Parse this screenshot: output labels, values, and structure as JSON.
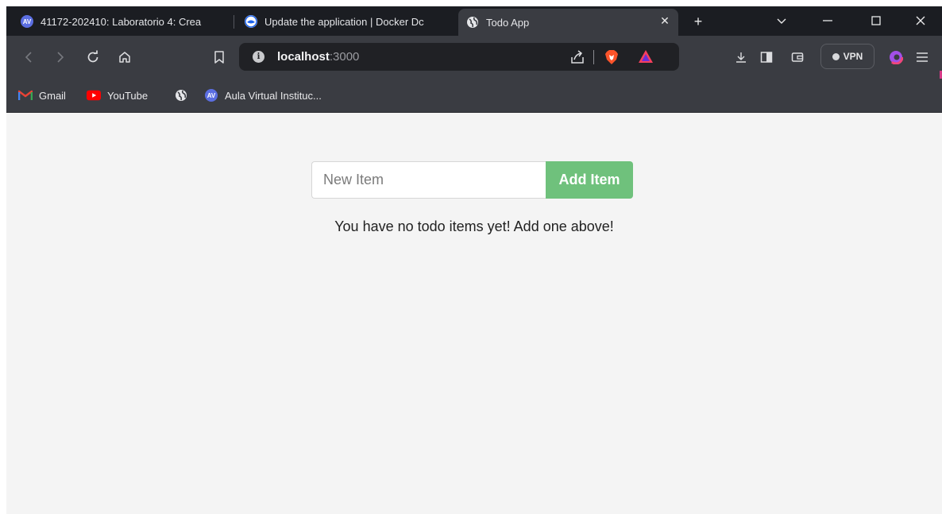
{
  "browser": {
    "tabs": [
      {
        "title": "41172-202410: Laboratorio 4: Crea",
        "favicon": "av-badge-icon"
      },
      {
        "title": "Update the application | Docker Dc",
        "favicon": "docker-docs-icon"
      },
      {
        "title": "Todo App",
        "favicon": "globe-icon",
        "active": true
      }
    ],
    "address": {
      "host": "localhost",
      "port": ":3000"
    },
    "vpn_label": "VPN",
    "bookmarks": [
      {
        "label": "Gmail",
        "icon": "gmail-icon"
      },
      {
        "label": "YouTube",
        "icon": "youtube-icon"
      },
      {
        "label": "",
        "icon": "globe-icon"
      },
      {
        "label": "Aula Virtual Instituc...",
        "icon": "av-badge-icon"
      }
    ]
  },
  "app": {
    "input_placeholder": "New Item",
    "input_value": "",
    "add_button_label": "Add Item",
    "empty_message": "You have no todo items yet! Add one above!"
  },
  "colors": {
    "accent_green": "#6fc17c",
    "page_background": "#f4f4f4",
    "browser_chrome": "#3a3c42"
  }
}
